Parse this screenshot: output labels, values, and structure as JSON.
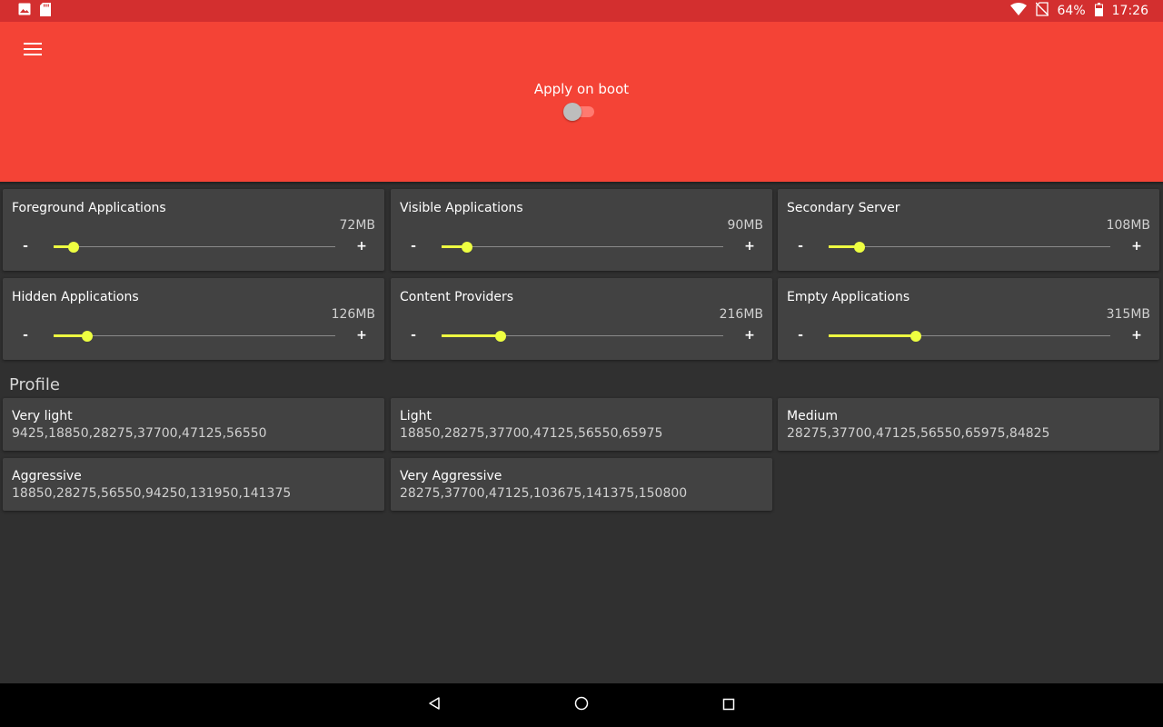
{
  "status_bar": {
    "battery": "64%",
    "time": "17:26",
    "icons": [
      "image-icon",
      "sd-card-icon",
      "wifi-icon",
      "no-sim-icon",
      "battery-icon"
    ]
  },
  "app_bar": {
    "menu_icon": "menu-icon",
    "apply_on_boot_label": "Apply on boot",
    "apply_on_boot_enabled": false,
    "accent_color": "#f44336"
  },
  "sliders": [
    {
      "title": "Foreground Applications",
      "value": "72MB",
      "minus": "-",
      "plus": "+",
      "level": 0.07
    },
    {
      "title": "Visible Applications",
      "value": "90MB",
      "minus": "-",
      "plus": "+",
      "level": 0.09
    },
    {
      "title": "Secondary Server",
      "value": "108MB",
      "minus": "-",
      "plus": "+",
      "level": 0.11
    },
    {
      "title": "Hidden Applications",
      "value": "126MB",
      "minus": "-",
      "plus": "+",
      "level": 0.12
    },
    {
      "title": "Content Providers",
      "value": "216MB",
      "minus": "-",
      "plus": "+",
      "level": 0.21
    },
    {
      "title": "Empty Applications",
      "value": "315MB",
      "minus": "-",
      "plus": "+",
      "level": 0.31
    }
  ],
  "slider_color": "#eeff41",
  "profile_section_title": "Profile",
  "profiles": [
    {
      "name": "Very light",
      "values": "9425,18850,28275,37700,47125,56550"
    },
    {
      "name": "Light",
      "values": "18850,28275,37700,47125,56550,65975"
    },
    {
      "name": "Medium",
      "values": "28275,37700,47125,56550,65975,84825"
    },
    {
      "name": "Aggressive",
      "values": "18850,28275,56550,94250,131950,141375"
    },
    {
      "name": "Very Aggressive",
      "values": "28275,37700,47125,103675,141375,150800"
    }
  ],
  "nav_bar": {
    "icons": [
      "back-icon",
      "home-icon",
      "recents-icon"
    ]
  }
}
